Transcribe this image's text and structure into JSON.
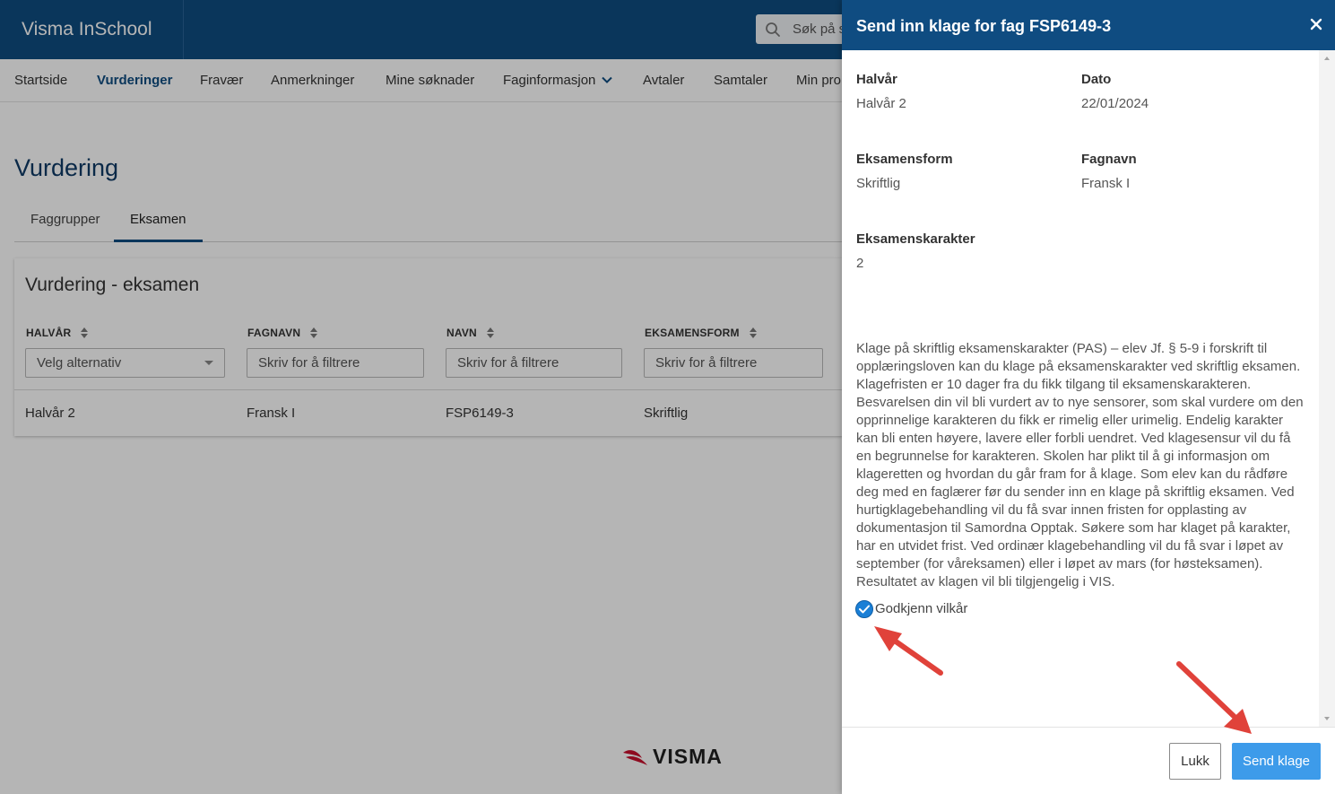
{
  "app": {
    "brand": "Visma InSchool",
    "search_placeholder": "Søk på s"
  },
  "nav": {
    "items": [
      "Startside",
      "Vurderinger",
      "Fravær",
      "Anmerkninger",
      "Mine søknader",
      "Faginformasjon",
      "Avtaler",
      "Samtaler",
      "Min pro"
    ],
    "active": "Vurderinger"
  },
  "page": {
    "title": "Vurdering",
    "tabs": [
      "Faggrupper",
      "Eksamen"
    ],
    "active_tab": "Eksamen"
  },
  "card": {
    "title": "Vurdering - eksamen",
    "columns": [
      "HALVÅR",
      "FAGNAVN",
      "NAVN",
      "EKSAMENSFORM"
    ],
    "filters": [
      "Velg alternativ",
      "Skriv for å filtrere",
      "Skriv for å filtrere",
      "Skriv for å filtrere"
    ],
    "rows": [
      [
        "Halvår 2",
        "Fransk I",
        "FSP6149-3",
        "Skriftlig"
      ]
    ]
  },
  "footer": {
    "logo_text": "VISMA"
  },
  "panel": {
    "title": "Send inn klage for fag FSP6149-3",
    "fields": {
      "halvar_label": "Halvår",
      "halvar_value": "Halvår 2",
      "dato_label": "Dato",
      "dato_value": "22/01/2024",
      "eksamensform_label": "Eksamensform",
      "eksamensform_value": "Skriftlig",
      "fagnavn_label": "Fagnavn",
      "fagnavn_value": "Fransk I",
      "karakter_label": "Eksamenskarakter",
      "karakter_value": "2"
    },
    "terms": "Klage på skriftlig eksamenskarakter (PAS) – elev Jf. § 5-9 i forskrift til opplæringsloven kan du klage på eksamenskarakter ved skriftlig eksamen. Klagefristen er 10 dager fra du fikk tilgang til eksamenskarakteren. Besvarelsen din vil bli vurdert av to nye sensorer, som skal vurdere om den opprinnelige karakteren du fikk er rimelig eller urimelig. Endelig karakter kan bli enten høyere, lavere eller forbli uendret. Ved klagesensur vil du få en begrunnelse for karakteren. Skolen har plikt til å gi informasjon om klageretten og hvordan du går fram for å klage. Som elev kan du rådføre deg med en faglærer før du sender inn en klage på skriftlig eksamen. Ved hurtigklagebehandling vil du få svar innen fristen for opplasting av dokumentasjon til Samordna Opptak. Søkere som har klaget på karakter, har en utvidet frist. Ved ordinær klagebehandling vil du få svar i løpet av september (for våreksamen) eller i løpet av mars (for høsteksamen). Resultatet av klagen vil bli tilgjengelig i VIS.",
    "checkbox_label": "Godkjenn vilkår",
    "checkbox_checked": true,
    "close_button": "Lukk",
    "send_button": "Send klage"
  },
  "colors": {
    "header": "#0f4c81",
    "primary_button": "#3d9bea",
    "checkbox": "#1a7fd6",
    "annotation_arrow": "#e0423a",
    "visma_red": "#c8102e"
  }
}
